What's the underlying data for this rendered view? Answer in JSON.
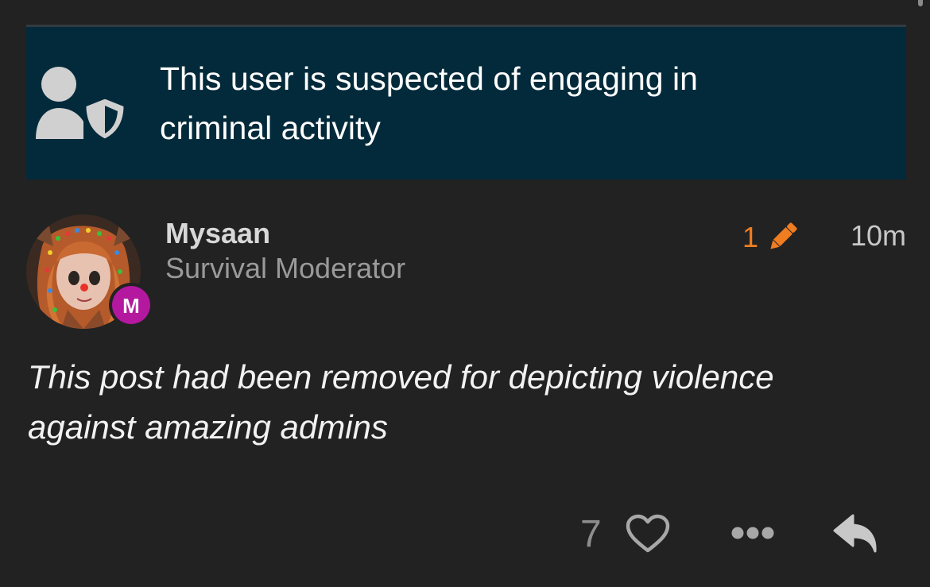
{
  "notice": {
    "line1": "This user is suspected of engaging in",
    "line2": "criminal activity",
    "icon": "user-shield-icon"
  },
  "post": {
    "username": "Mysaan",
    "user_title": "Survival Moderator",
    "badge_text": "M",
    "edit_count": "1",
    "time": "10m",
    "body_line1": "This post had been removed for depicting violence",
    "body_line2": "against amazing admins",
    "like_count": "7"
  },
  "colors": {
    "background": "#222222",
    "notice_background": "#032a3a",
    "edit_accent": "#f07d20",
    "badge": "#b3189f"
  }
}
